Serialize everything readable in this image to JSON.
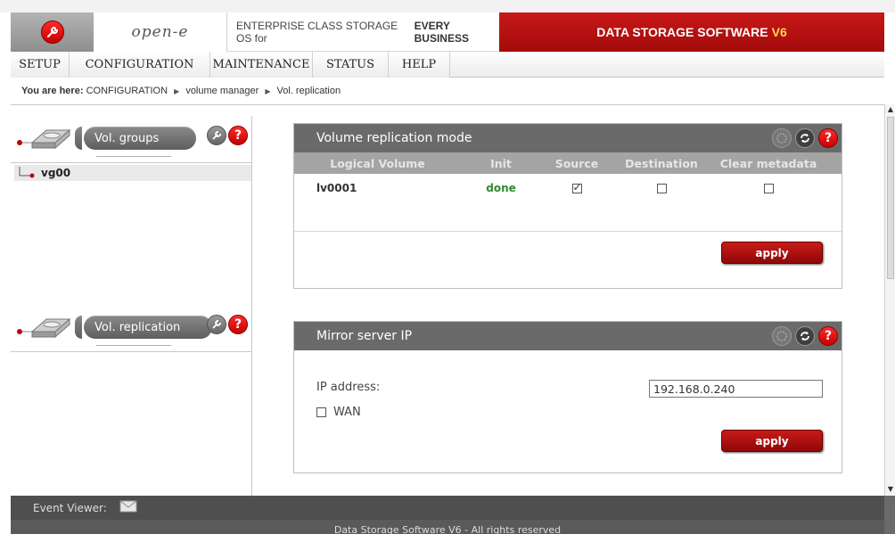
{
  "header": {
    "brand": "open-e",
    "tagline_prefix": "ENTERPRISE CLASS STORAGE OS for ",
    "tagline_bold": "EVERY BUSINESS",
    "product": "DATA STORAGE SOFTWARE",
    "product_version": "V6"
  },
  "menu": [
    "SETUP",
    "CONFIGURATION",
    "MAINTENANCE",
    "STATUS",
    "HELP"
  ],
  "breadcrumb": {
    "prefix": "You are here:",
    "items": [
      "CONFIGURATION",
      "volume manager",
      "Vol. replication"
    ]
  },
  "left_panels": {
    "vol_groups": {
      "title": "Vol. groups",
      "tree": [
        "vg00"
      ]
    },
    "vol_replication": {
      "title": "Vol. replication"
    }
  },
  "replication_mode": {
    "title": "Volume replication mode",
    "columns": [
      "Logical Volume",
      "Init",
      "Source",
      "Destination",
      "Clear metadata"
    ],
    "rows": [
      {
        "volume": "lv0001",
        "init": "done",
        "source": true,
        "destination": false,
        "clear_metadata": false
      }
    ],
    "apply_label": "apply"
  },
  "mirror_server": {
    "title": "Mirror server IP",
    "ip_label": "IP address:",
    "ip_value": "192.168.0.240",
    "wan_label": "WAN",
    "wan_checked": false,
    "apply_label": "apply"
  },
  "footer": {
    "event_viewer": "Event Viewer:",
    "copyright": "Data Storage Software V6 - All rights reserved"
  },
  "colors": {
    "accent_red": "#c81a1a",
    "status_done": "#2f8a2f",
    "panel_title_bg": "#6a6a6a",
    "column_header_bg": "#a4a4a4"
  }
}
